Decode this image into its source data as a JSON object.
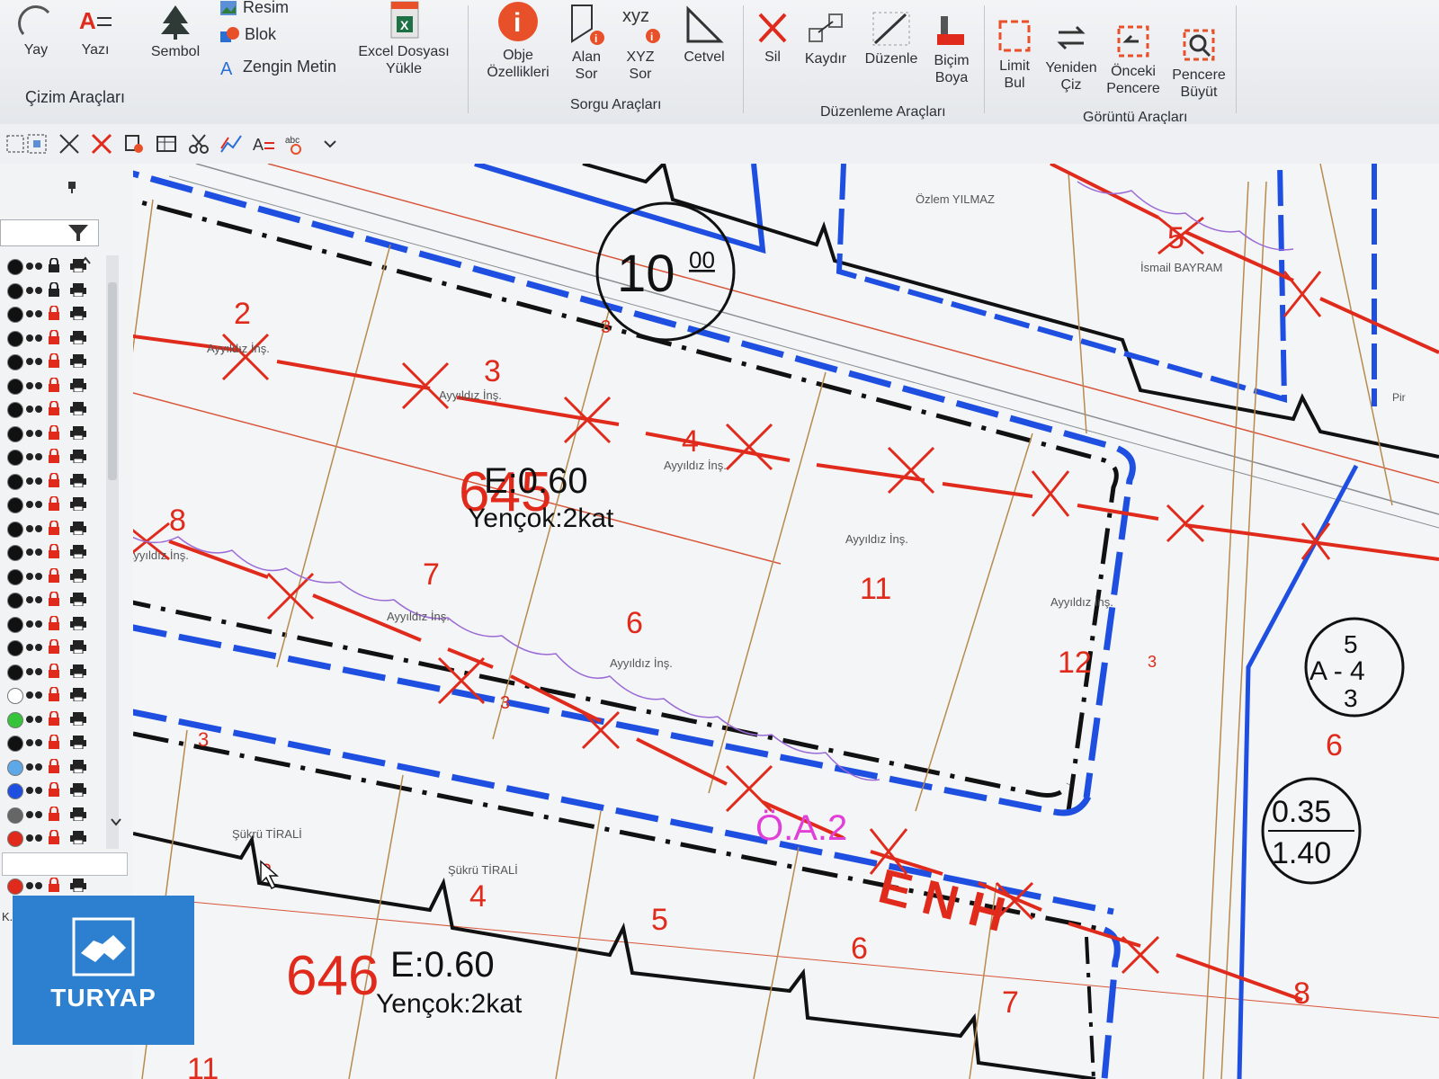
{
  "ribbon": {
    "yay": "Yay",
    "yazi": "Yazı",
    "sembol": "Sembol",
    "resim": "Resim",
    "blok": "Blok",
    "zengin_metin": "Zengin Metin",
    "excel_line1": "Excel Dosyası",
    "excel_line2": "Yükle",
    "obje_line1": "Obje",
    "obje_line2": "Özellikleri",
    "alan_line1": "Alan",
    "alan_line2": "Sor",
    "xyz_top": "xyz",
    "xyz_line1": "XYZ",
    "xyz_line2": "Sor",
    "cetvel": "Cetvel",
    "sil": "Sil",
    "kaydir": "Kaydır",
    "duzenle": "Düzenle",
    "bicim_line1": "Biçim",
    "bicim_line2": "Boya",
    "limit_line1": "Limit",
    "limit_line2": "Bul",
    "yeniden_line1": "Yeniden",
    "yeniden_line2": "Çiz",
    "onceki_line1": "Önceki",
    "onceki_line2": "Pencere",
    "pencere_line1": "Pencere",
    "pencere_line2": "Büyüt",
    "groups": {
      "cizim": "Çizim Araçları",
      "sorgu": "Sorgu Araçları",
      "duzenleme": "Düzenleme Araçları",
      "goruntu": "Görüntü Araçları"
    }
  },
  "drawing": {
    "road_width": "10",
    "road_width_sup": "00",
    "names": {
      "ozlem": "Özlem YILMAZ",
      "ismail": "İsmail BAYRAM",
      "ayyildiz": "Ayyıldız İnş.",
      "sukru": "Şükrü TİRALİ",
      "pir": "Pir"
    },
    "parcels": [
      "2",
      "3",
      "4",
      "8",
      "7",
      "6",
      "11",
      "12",
      "4",
      "5",
      "6",
      "7",
      "8",
      "5",
      "6",
      "11"
    ],
    "block_645": {
      "number": "645",
      "e": "E:0.60",
      "floors": "Yençok:2kat"
    },
    "block_646": {
      "number": "646",
      "e": "E:0.60",
      "floors": "Yençok:2kat"
    },
    "setback": "3",
    "oa": "Ö.A.2",
    "enh": "ENH",
    "zone_top": "5",
    "zone_mid": "A - 4",
    "zone_bot": "3",
    "ratio_top": "0.35",
    "ratio_bot": "1.40",
    "right_parcel": "6"
  },
  "file_tab": "K.NCZ",
  "logo_text": "TURYAP",
  "colors": {
    "accent_red": "#e02a1c",
    "blue": "#1f4fe0",
    "logo_blue": "#2d7fd0"
  }
}
